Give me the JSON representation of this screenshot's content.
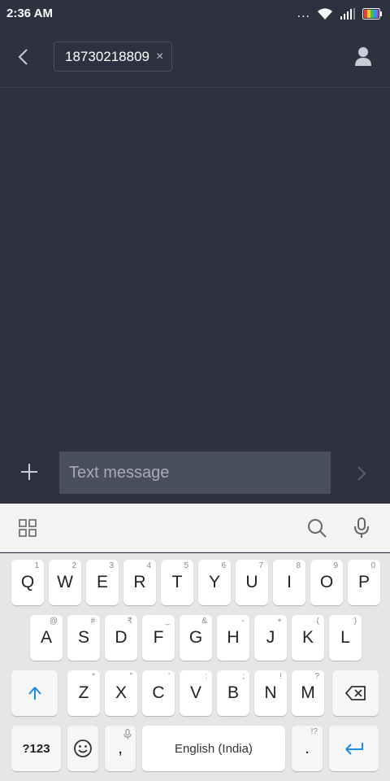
{
  "status_bar": {
    "time": "2:36 AM",
    "more": "..."
  },
  "header": {
    "recipient": "18730218809",
    "remove": "×"
  },
  "compose": {
    "placeholder": "Text message"
  },
  "keyboard": {
    "row1": [
      {
        "label": "Q",
        "hint": "1"
      },
      {
        "label": "W",
        "hint": "2"
      },
      {
        "label": "E",
        "hint": "3"
      },
      {
        "label": "R",
        "hint": "4"
      },
      {
        "label": "T",
        "hint": "5"
      },
      {
        "label": "Y",
        "hint": "6"
      },
      {
        "label": "U",
        "hint": "7"
      },
      {
        "label": "I",
        "hint": "8"
      },
      {
        "label": "O",
        "hint": "9"
      },
      {
        "label": "P",
        "hint": "0"
      }
    ],
    "row2": [
      {
        "label": "A",
        "hint": "@"
      },
      {
        "label": "S",
        "hint": "#"
      },
      {
        "label": "D",
        "hint": "₹"
      },
      {
        "label": "F",
        "hint": "_"
      },
      {
        "label": "G",
        "hint": "&"
      },
      {
        "label": "H",
        "hint": "-"
      },
      {
        "label": "J",
        "hint": "+"
      },
      {
        "label": "K",
        "hint": "("
      },
      {
        "label": "L",
        "hint": ")"
      }
    ],
    "row3": [
      {
        "label": "Z",
        "hint": "*"
      },
      {
        "label": "X",
        "hint": "\""
      },
      {
        "label": "C",
        "hint": "'"
      },
      {
        "label": "V",
        "hint": ":"
      },
      {
        "label": "B",
        "hint": ";"
      },
      {
        "label": "N",
        "hint": "!"
      },
      {
        "label": "M",
        "hint": "?"
      }
    ],
    "symbols_label": "?123",
    "comma": ",",
    "space_label": "English (India)",
    "period": ".",
    "period_hint": "!?"
  },
  "colors": {
    "background": "#2e3240",
    "input": "#4a4f5e",
    "keyboard": "#e6e6e8",
    "accent": "#1a8ce0"
  },
  "icons": [
    "back-icon",
    "close-icon",
    "contact-icon",
    "plus-icon",
    "send-icon",
    "grid-icon",
    "search-icon",
    "mic-icon",
    "shift-icon",
    "backspace-icon",
    "emoji-icon",
    "enter-icon",
    "wifi-icon",
    "signal-icon",
    "battery-icon"
  ]
}
